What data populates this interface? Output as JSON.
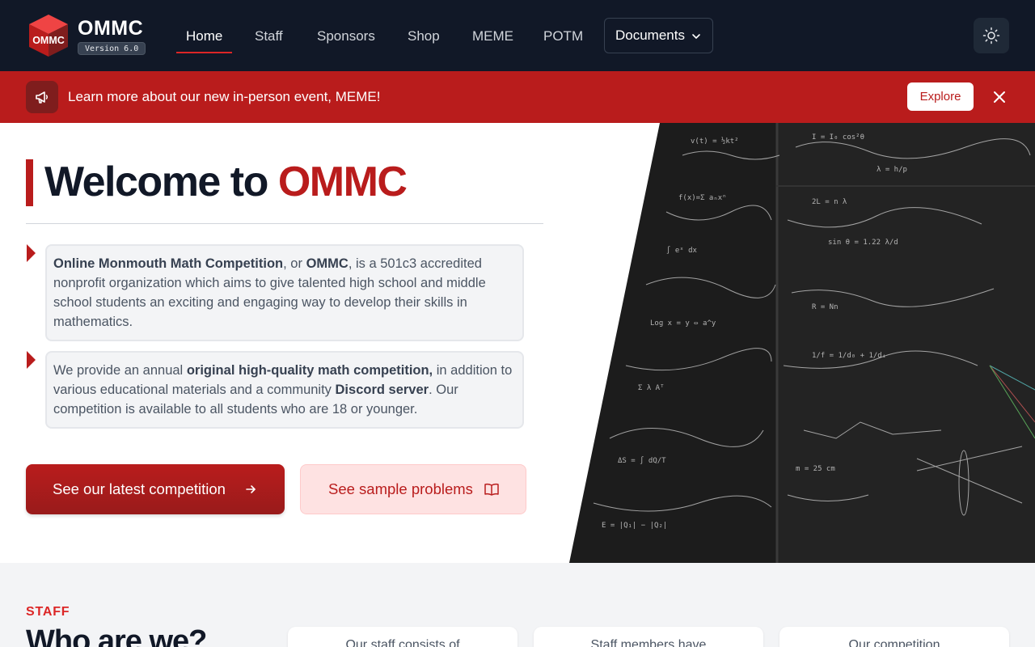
{
  "brand": {
    "name": "OMMC",
    "logo_text": "OMMC",
    "version": "Version 6.0"
  },
  "nav": {
    "items": [
      {
        "label": "Home",
        "active": true
      },
      {
        "label": "Staff"
      },
      {
        "label": "Sponsors"
      },
      {
        "label": "Shop"
      },
      {
        "label": "MEME"
      },
      {
        "label": "POTM"
      }
    ],
    "documents_label": "Documents"
  },
  "banner": {
    "text": "Learn more about our new in-person event, MEME!",
    "explore_label": "Explore"
  },
  "hero": {
    "title_prefix": "Welcome to ",
    "title_accent": "OMMC",
    "card1": {
      "b1": "Online Monmouth Math Competition",
      "t1": ", or ",
      "b2": "OMMC",
      "t2": ", is a 501c3 accredited nonprofit organization which aims to give talented high school and middle school students an exciting and engaging way to develop their skills in mathematics."
    },
    "card2": {
      "t1": "We provide an annual ",
      "b1": "original high-quality math competition,",
      "t2": " in addition to various educational materials and a community ",
      "b2": "Discord server",
      "t3": ". Our competition is available to all students who are 18 or younger."
    },
    "primary_button": "See our latest competition",
    "secondary_button": "See sample problems"
  },
  "staff_section": {
    "eyebrow": "STAFF",
    "heading": "Who are we?",
    "cards": [
      "Our staff consists of",
      "Staff members have",
      "Our competition"
    ]
  },
  "colors": {
    "navy": "#111827",
    "brand_red": "#b91c1c",
    "accent_red": "#dc2626"
  },
  "icons": {
    "banner": "megaphone-icon",
    "theme": "sun-icon",
    "close": "close-icon",
    "arrow": "arrow-right-icon",
    "book": "book-open-icon",
    "chevron": "chevron-down-icon"
  }
}
